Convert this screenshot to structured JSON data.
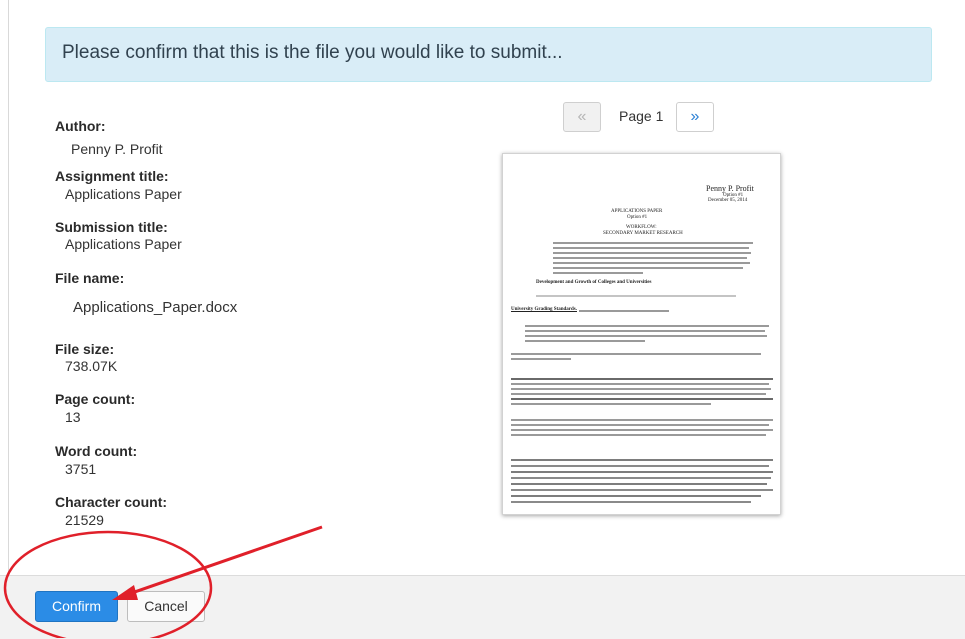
{
  "banner": {
    "text": "Please confirm that this is the file you would like to submit..."
  },
  "metadata": {
    "author_label": "Author:",
    "author_value": "Penny P. Profit",
    "assignment_title_label": "Assignment title:",
    "assignment_title_value": "Applications Paper",
    "submission_title_label": "Submission title:",
    "submission_title_value": "Applications Paper",
    "file_name_label": "File name:",
    "file_name_value": "Applications_Paper.docx",
    "file_size_label": "File size:",
    "file_size_value": "738.07K",
    "page_count_label": "Page count:",
    "page_count_value": "13",
    "word_count_label": "Word count:",
    "word_count_value": "3751",
    "character_count_label": "Character count:",
    "character_count_value": "21529"
  },
  "pager": {
    "prev_icon": "«",
    "page_label": "Page 1",
    "next_icon": "»"
  },
  "preview": {
    "author": "Penny  P.  Profit",
    "option": "Option #1",
    "date": "December 05, 2014",
    "title": "APPLICATIONS PAPER",
    "title_option": "Option #1",
    "workflow": "WORKFLOW:",
    "subtitle": "SECONDARY MARKET RESEARCH",
    "section_heading": "Development and Growth of Colleges and Universities",
    "ugs_heading": "University Grading Standards."
  },
  "footer": {
    "confirm_label": "Confirm",
    "cancel_label": "Cancel"
  },
  "annotations": {
    "circle_color": "#e0202a",
    "arrow_color": "#e0202a"
  }
}
